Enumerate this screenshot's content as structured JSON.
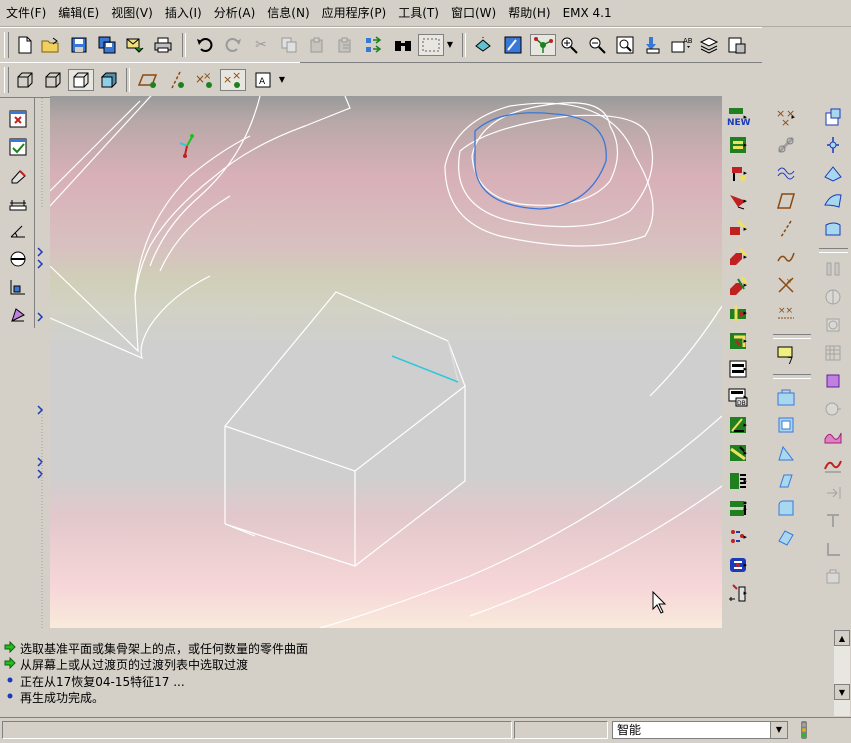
{
  "menu": [
    "文件(F)",
    "编辑(E)",
    "视图(V)",
    "插入(I)",
    "分析(A)",
    "信息(N)",
    "应用程序(P)",
    "工具(T)",
    "窗口(W)",
    "帮助(H)",
    "EMX 4.1"
  ],
  "messages": [
    {
      "icon": "green-arrow-icon",
      "text": "选取基准平面或集骨架上的点，或任何数量的零件曲面"
    },
    {
      "icon": "green-arrow-icon",
      "text": "从屏幕上或从过渡页的过渡列表中选取过渡"
    },
    {
      "icon": "blue-dot-icon",
      "text": "正在从17恢复04-15特征17 ..."
    },
    {
      "icon": "blue-dot-icon",
      "text": "再生成功完成。"
    }
  ],
  "status": {
    "selection_filter": "智能"
  },
  "colors": {
    "highlight_blue": "#3a78d8",
    "cyan_datum": "#30c8d8",
    "tool_green": "#207a20"
  }
}
